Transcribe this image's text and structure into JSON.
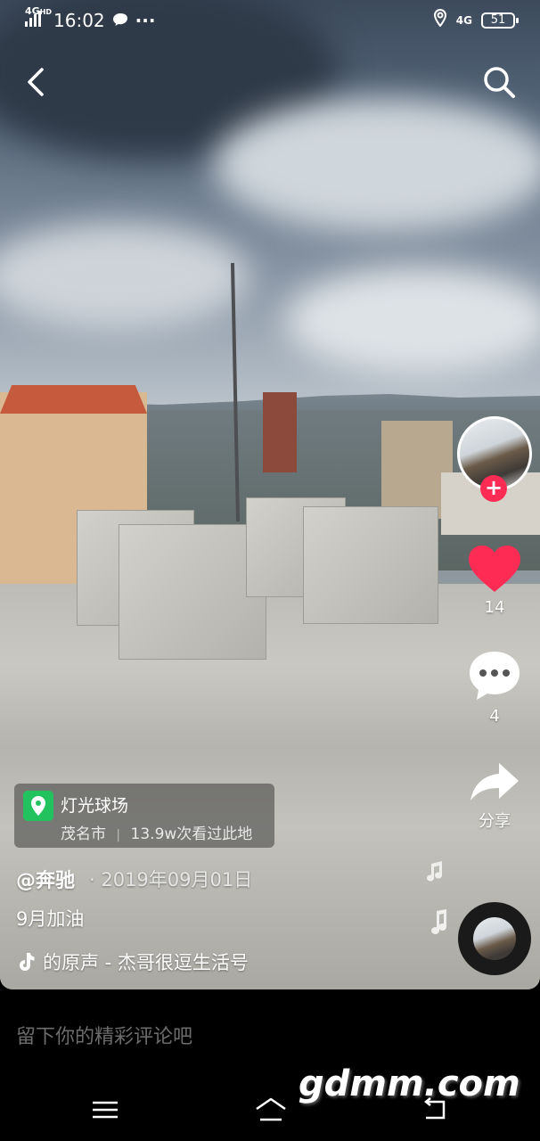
{
  "status_bar": {
    "network": "4G",
    "network_sub": "HD",
    "time": "16:02",
    "right_network": "4G",
    "battery": "51"
  },
  "post": {
    "location": {
      "name": "灯光球场",
      "city": "茂名市",
      "views": "13.9w次看过此地"
    },
    "author": "@奔驰",
    "date": "· 2019年09月01日",
    "caption": "9月加油",
    "music": "的原声 - 杰哥很逗生活号"
  },
  "actions": {
    "likes": "14",
    "comments": "4",
    "share": "分享"
  },
  "comment_input": {
    "placeholder": "留下你的精彩评论吧"
  },
  "watermark": "gdmm.com",
  "icons": [
    "back-arrow-icon",
    "search-icon",
    "heart-icon",
    "comment-icon",
    "share-icon",
    "location-pin-icon",
    "tiktok-note-icon",
    "music-note-icon",
    "menu-icon",
    "home-icon",
    "back-nav-icon"
  ],
  "colors": {
    "accent_red": "#fe2c55",
    "location_green": "#22c35e"
  }
}
